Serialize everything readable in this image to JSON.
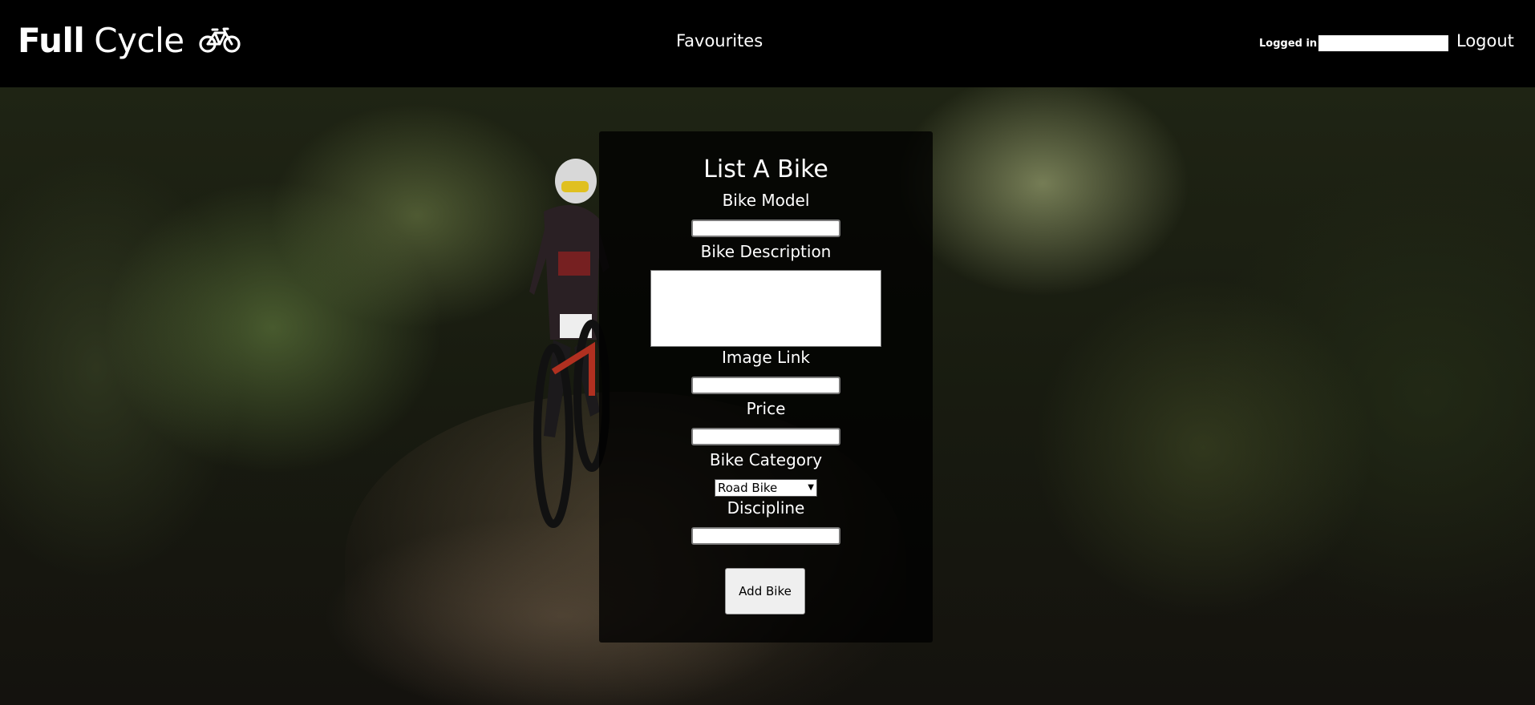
{
  "header": {
    "brand_bold": "Full",
    "brand_light": "Cycle",
    "brand_icon": "bicycle-icon",
    "nav_favourites": "Favourites",
    "logged_in_label": "Logged in",
    "logged_in_user": "",
    "logout_label": "Logout"
  },
  "background": {
    "description_icon": "forest-trail-photo"
  },
  "form": {
    "title": "List A Bike",
    "bike_model_label": "Bike Model",
    "bike_model_value": "",
    "bike_description_label": "Bike Description",
    "bike_description_value": "",
    "image_link_label": "Image Link",
    "image_link_value": "",
    "price_label": "Price",
    "price_value": "",
    "bike_category_label": "Bike Category",
    "bike_category_selected": "Road Bike",
    "discipline_label": "Discipline",
    "discipline_value": "",
    "submit_label": "Add Bike"
  },
  "colors": {
    "navbar_bg": "#000000",
    "panel_bg": "rgba(0,0,0,0.78)",
    "text": "#ffffff"
  }
}
